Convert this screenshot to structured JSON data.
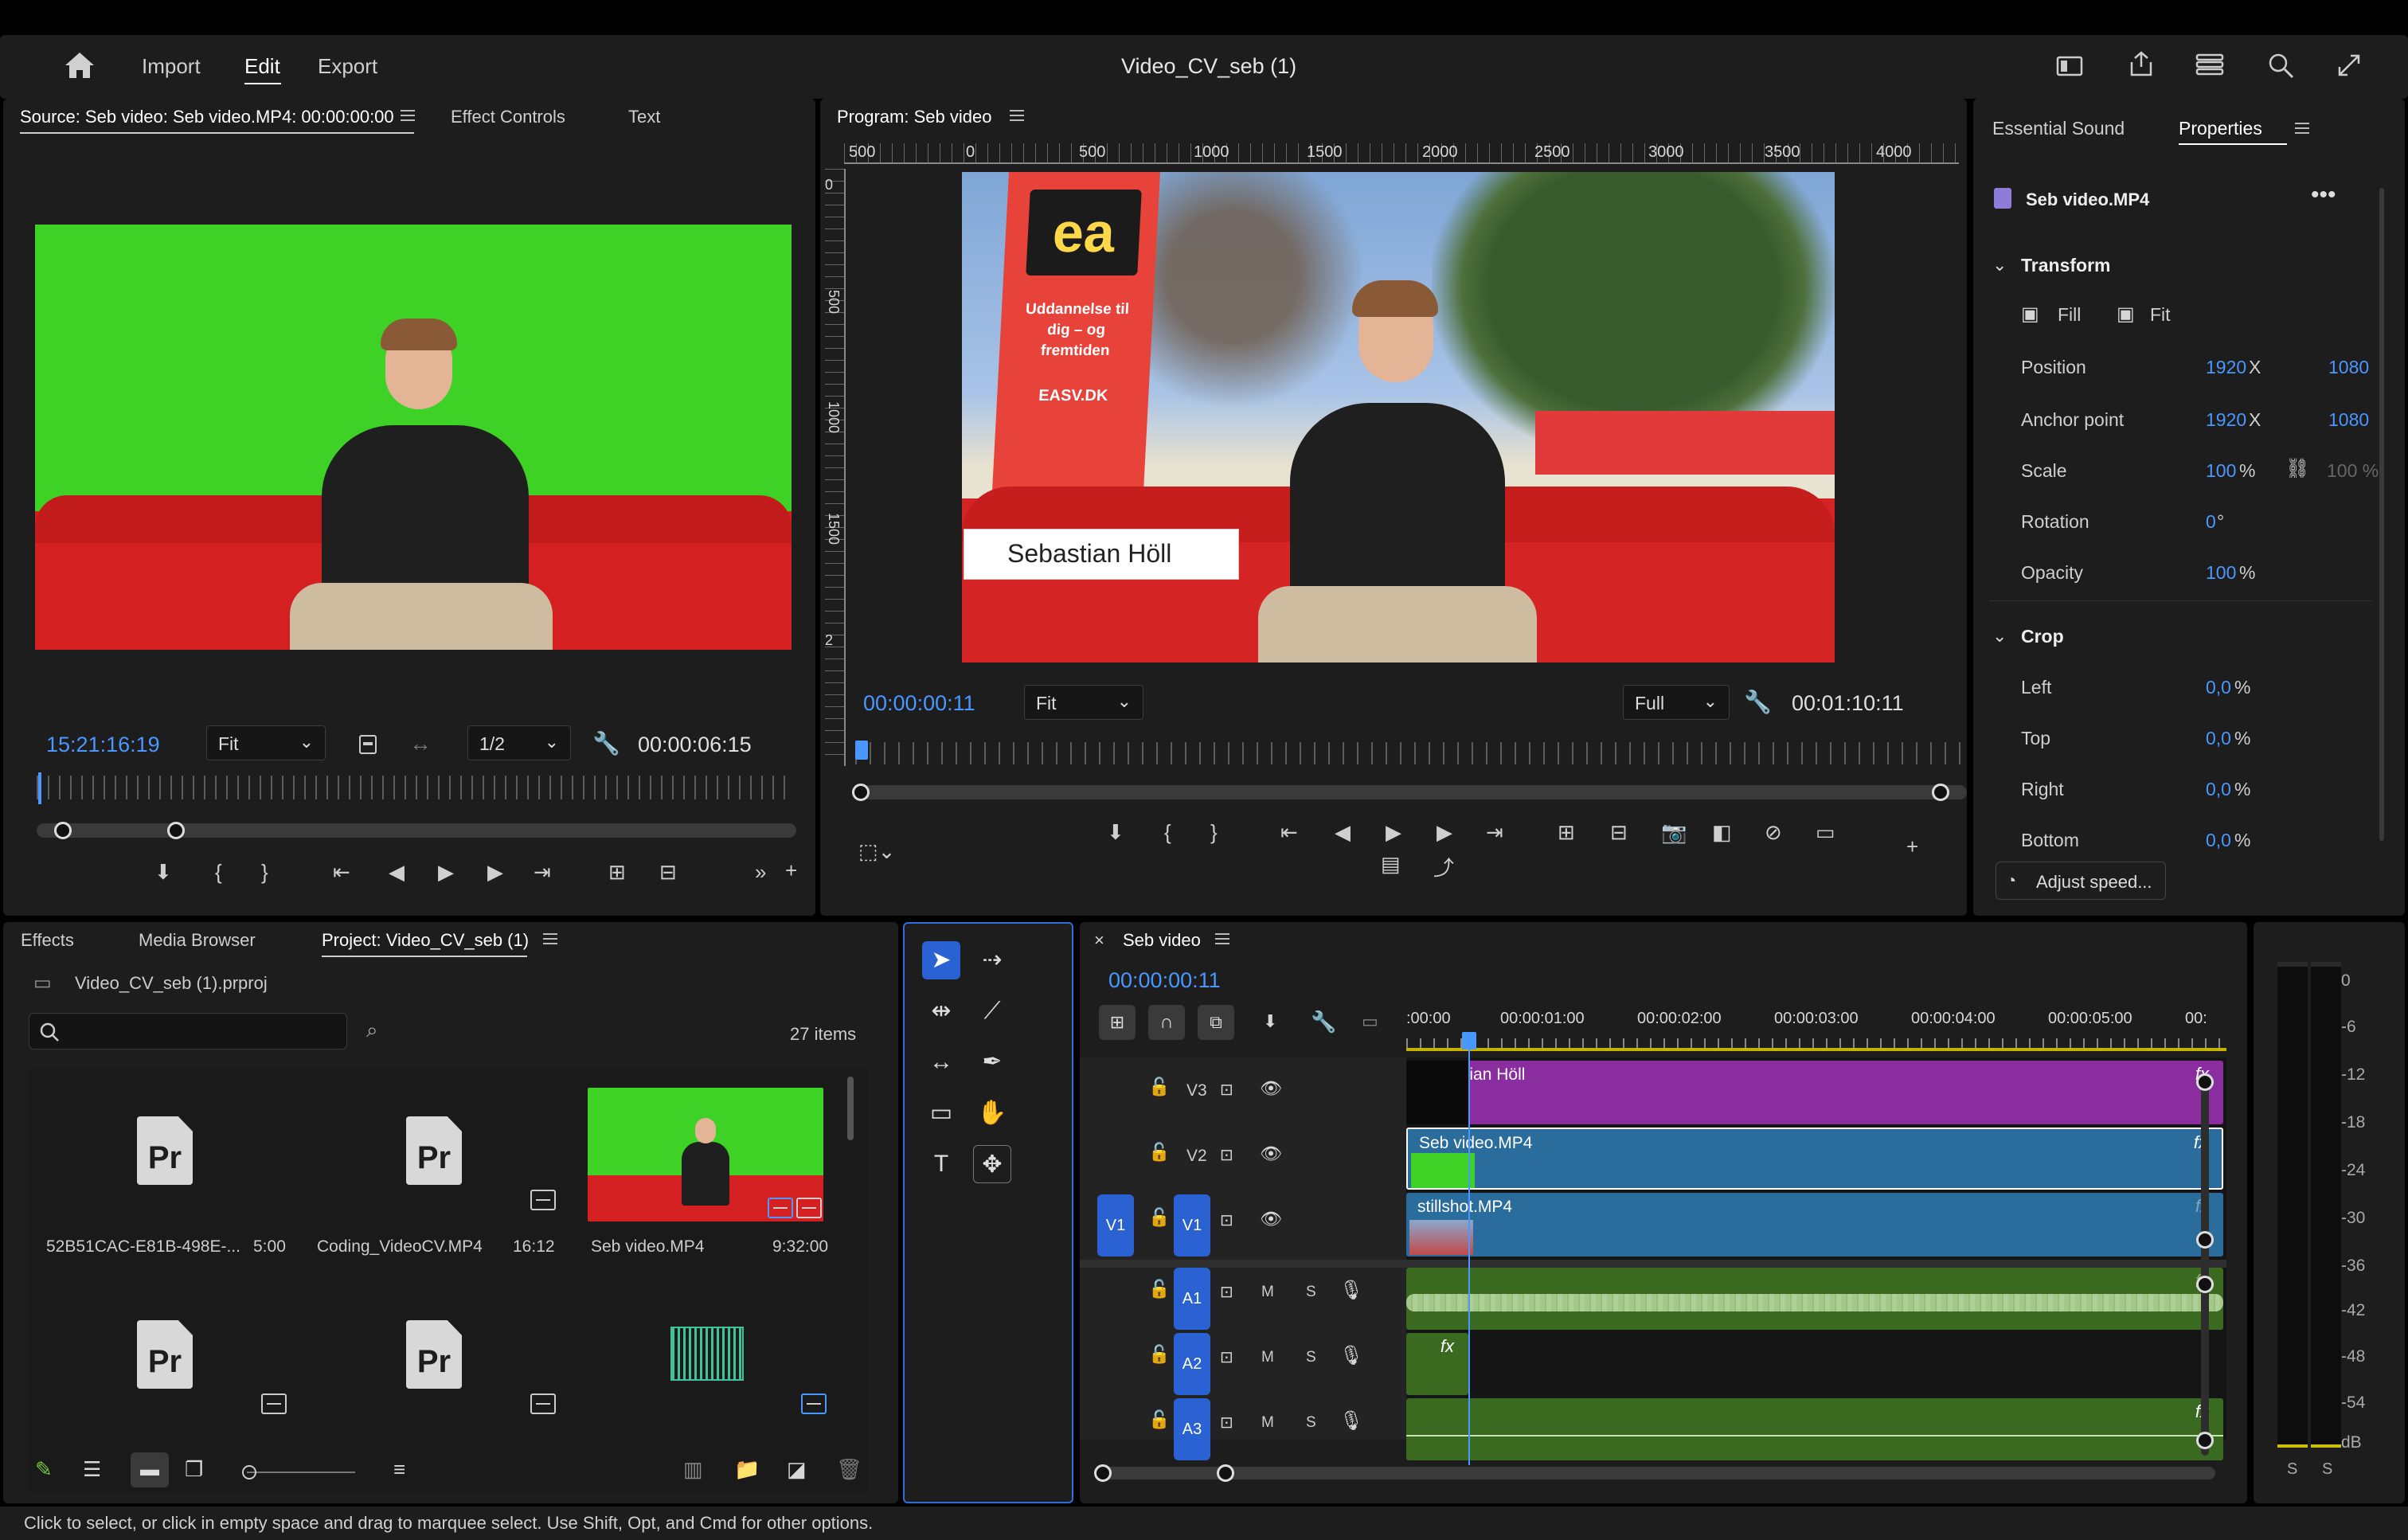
{
  "header": {
    "nav": [
      "Import",
      "Edit",
      "Export"
    ],
    "title": "Video_CV_seb (1)"
  },
  "source_panel": {
    "tabs": [
      "Source: Seb video: Seb video.MP4: 00:00:00:00",
      "Effect Controls",
      "Text"
    ],
    "timecode": "15:21:16:19",
    "fit": "Fit",
    "resolution": "1/2",
    "duration": "00:00:06:15"
  },
  "program_panel": {
    "title": "Program: Seb video",
    "ruler": [
      "500",
      "0",
      "500",
      "1000",
      "1500",
      "2000",
      "2500",
      "3000",
      "3500",
      "4000"
    ],
    "vruler": [
      "0",
      "500",
      "1000",
      "1500",
      "2"
    ],
    "lower_third": "Sebastian Höll",
    "sign_text": "Uddannelse til dig – og fremtiden",
    "sign_url": "EASV.DK",
    "timecode": "00:00:00:11",
    "fit": "Fit",
    "quality": "Full",
    "duration": "00:01:10:11"
  },
  "properties_panel": {
    "tabs": [
      "Essential Sound",
      "Properties"
    ],
    "clip_name": "Seb video.MP4",
    "transform": {
      "heading": "Transform",
      "fill": "Fill",
      "fit": "Fit",
      "position": {
        "label": "Position",
        "x": "1920",
        "x_unit": "X",
        "y": "1080"
      },
      "anchor": {
        "label": "Anchor point",
        "x": "1920",
        "x_unit": "X",
        "y": "1080"
      },
      "scale": {
        "label": "Scale",
        "value": "100",
        "unit": "%",
        "linked": "100 %"
      },
      "rotation": {
        "label": "Rotation",
        "value": "0",
        "unit": "°"
      },
      "opacity": {
        "label": "Opacity",
        "value": "100",
        "unit": "%"
      }
    },
    "crop": {
      "heading": "Crop",
      "rows": [
        {
          "label": "Left",
          "value": "0,0",
          "unit": "%"
        },
        {
          "label": "Top",
          "value": "0,0",
          "unit": "%"
        },
        {
          "label": "Right",
          "value": "0,0",
          "unit": "%"
        },
        {
          "label": "Bottom",
          "value": "0,0",
          "unit": "%"
        }
      ]
    },
    "adjust_speed": "Adjust speed..."
  },
  "project_panel": {
    "tabs": [
      "Effects",
      "Media Browser",
      "Project: Video_CV_seb (1)"
    ],
    "project_file": "Video_CV_seb (1).prproj",
    "search_placeholder": "",
    "item_count": "27 items",
    "items": [
      {
        "name": "52B51CAC-E81B-498E-...",
        "duration": "5:00"
      },
      {
        "name": "Coding_VideoCV.MP4",
        "duration": "16:12"
      },
      {
        "name": "Seb video.MP4",
        "duration": "9:32:00"
      }
    ]
  },
  "timeline": {
    "sequence": "Seb video",
    "timecode": "00:00:00:11",
    "ruler": [
      ":00:00",
      "00:00:01:00",
      "00:00:02:00",
      "00:00:03:00",
      "00:00:04:00",
      "00:00:05:00",
      "00:"
    ],
    "video_tracks": [
      {
        "name": "V3",
        "clip": "Sebastian Höll"
      },
      {
        "name": "V2",
        "clip": "Seb video.MP4"
      },
      {
        "name": "V1",
        "source": "V1",
        "clip": "stillshot.MP4"
      }
    ],
    "audio_tracks": [
      {
        "name": "A1",
        "m": "M",
        "s": "S"
      },
      {
        "name": "A2",
        "m": "M",
        "s": "S"
      },
      {
        "name": "A3",
        "m": "M",
        "s": "S"
      }
    ],
    "fx": "fx"
  },
  "meter": {
    "labels": [
      "0",
      "-6",
      "-12",
      "-18",
      "-24",
      "-30",
      "-36",
      "-42",
      "-48",
      "-54",
      "dB"
    ],
    "solo": [
      "S",
      "S"
    ]
  },
  "status_bar": "Click to select, or click in empty space and drag to marquee select. Use Shift, Opt, and Cmd for other options."
}
